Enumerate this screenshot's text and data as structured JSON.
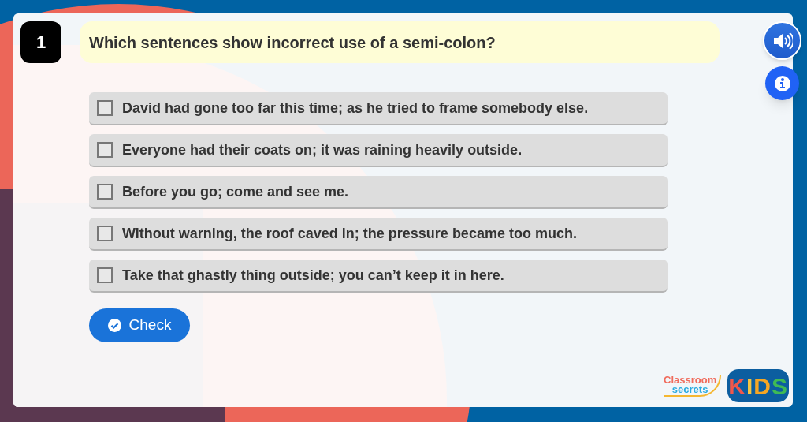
{
  "question": {
    "number": "1",
    "text": "Which sentences show incorrect use of a semi-colon?"
  },
  "options": [
    {
      "text": "David had gone too far this time; as he tried to frame somebody else.",
      "checked": false
    },
    {
      "text": "Everyone had their coats on; it was raining heavily outside.",
      "checked": false
    },
    {
      "text": "Before you go; come and see me.",
      "checked": false
    },
    {
      "text": "Without warning, the roof caved in; the pressure became too much.",
      "checked": false
    },
    {
      "text": "Take that ghastly thing outside; you can’t keep it in here.",
      "checked": false
    }
  ],
  "check_button": {
    "label": "Check"
  },
  "logo": {
    "line_1": "Classroom",
    "line_2": "secrets",
    "badge": "KIDS"
  }
}
